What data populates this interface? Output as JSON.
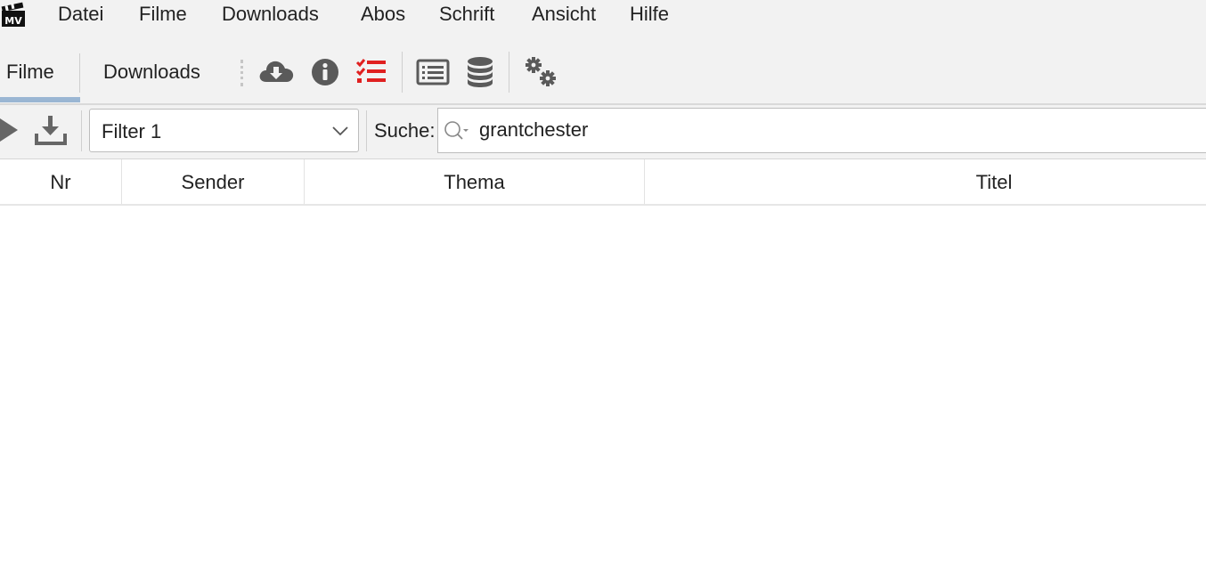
{
  "app": {
    "logo_icon": "mediathekview-clapperboard-icon",
    "logo_text": "MV"
  },
  "menu": {
    "items": [
      "Datei",
      "Filme",
      "Downloads",
      "Abos",
      "Schrift",
      "Ansicht",
      "Hilfe"
    ]
  },
  "toolbar": {
    "tabs": [
      {
        "label": "Filme",
        "selected": true
      },
      {
        "label": "Downloads",
        "selected": false
      }
    ],
    "icons": [
      {
        "name": "cloud-download-icon"
      },
      {
        "name": "info-icon"
      },
      {
        "name": "checklist-icon",
        "color": "#e02020"
      },
      {
        "name": "list-view-icon"
      },
      {
        "name": "database-icon"
      },
      {
        "name": "settings-gears-icon"
      }
    ],
    "indicator_color": "#9ab6d3"
  },
  "filterbar": {
    "play_icon": "play-icon",
    "download_icon": "download-icon",
    "filter_select": {
      "value": "Filter 1"
    },
    "search": {
      "label": "Suche:",
      "value": "grantchester"
    }
  },
  "table": {
    "columns": [
      "Nr",
      "Sender",
      "Thema",
      "Titel"
    ],
    "rows": []
  }
}
